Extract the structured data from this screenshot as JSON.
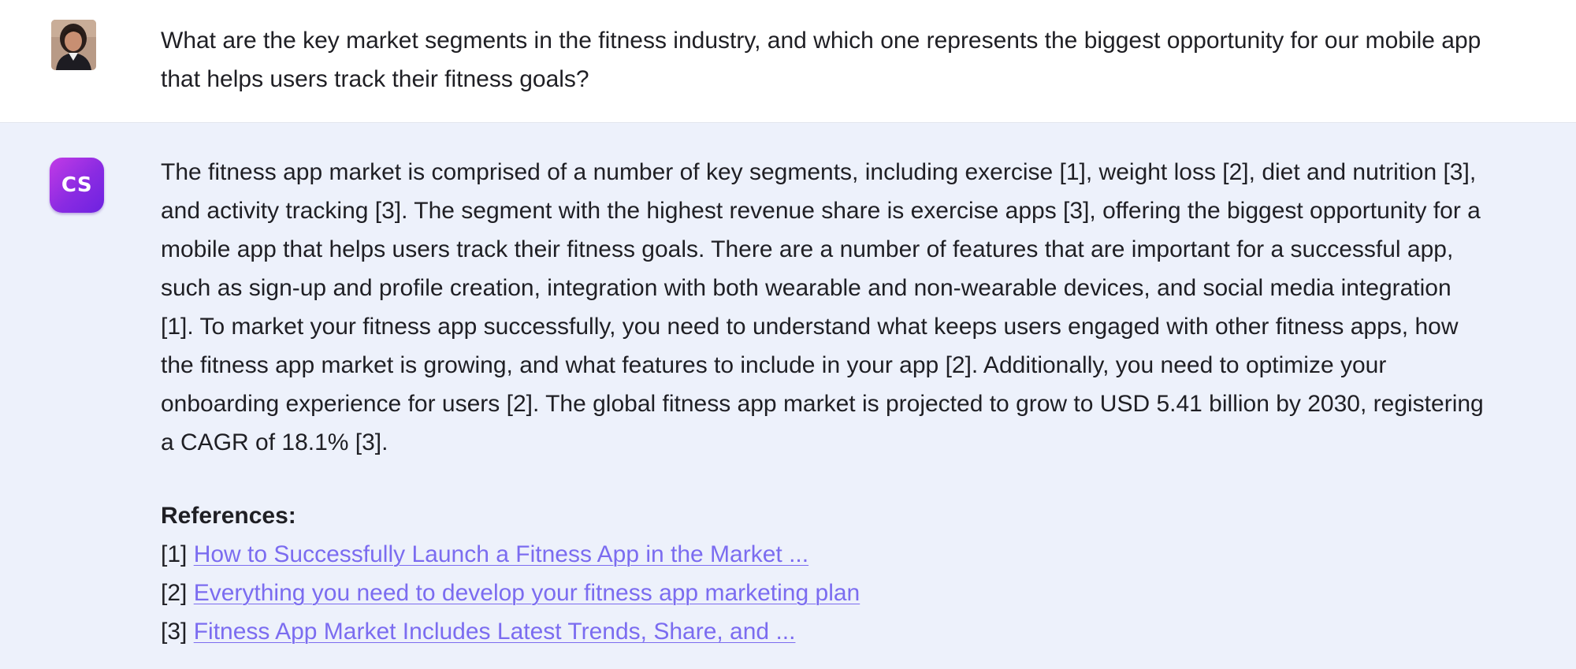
{
  "user_message": {
    "avatar": "user-avatar-photo",
    "text": "What are the key market segments in the fitness industry, and which one represents the biggest opportunity for our mobile app that helps users track their fitness goals?"
  },
  "assistant_message": {
    "avatar_label": "CS",
    "text": "The fitness app market is comprised of a number of key segments, including exercise [1], weight loss [2], diet and nutrition [3], and activity tracking [3]. The segment with the highest revenue share is exercise apps [3], offering the biggest opportunity for a mobile app that helps users track their fitness goals. There are a number of features that are important for a successful app, such as sign-up and profile creation, integration with both wearable and non-wearable devices, and social media integration [1]. To market your fitness app successfully, you need to understand what keeps users engaged with other fitness apps, how the fitness app market is growing, and what features to include in your app [2]. Additionally, you need to optimize your onboarding experience for users [2]. The global fitness app market is projected to grow to USD 5.41 billion by 2030, registering a CAGR of 18.1% [3].",
    "references_title": "References:",
    "references": [
      {
        "marker": "[1]",
        "label": "How to Successfully Launch a Fitness App in the Market ..."
      },
      {
        "marker": "[2]",
        "label": "Everything you need to develop your fitness app marketing plan"
      },
      {
        "marker": "[3]",
        "label": "Fitness App Market Includes Latest Trends, Share, and ..."
      }
    ]
  },
  "colors": {
    "assistant_bg": "#edf1fb",
    "link": "#7b6cf0",
    "avatar_gradient_start": "#c23be6",
    "avatar_gradient_end": "#6d22e0"
  }
}
